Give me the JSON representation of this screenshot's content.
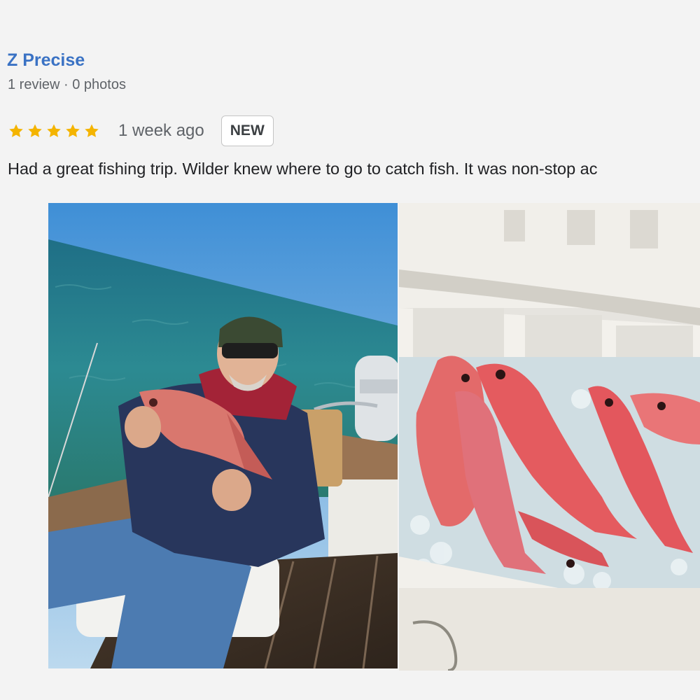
{
  "reviewer": {
    "name": "Z Precise",
    "meta": "1 review · 0 photos"
  },
  "review": {
    "rating": 5,
    "rating_max": 5,
    "time_ago": "1 week ago",
    "badge": "NEW",
    "text": "Had a great fishing trip. Wilder knew where to go to catch fish. It was non-stop ac"
  },
  "photos": [
    {
      "icon": "photo-angler-holding-fish"
    },
    {
      "icon": "photo-cooler-red-snapper"
    }
  ],
  "colors": {
    "accent": "#3a72c4",
    "star": "#f4b400",
    "background": "#f3f3f3",
    "text": "#202124",
    "muted": "#5f6368"
  }
}
